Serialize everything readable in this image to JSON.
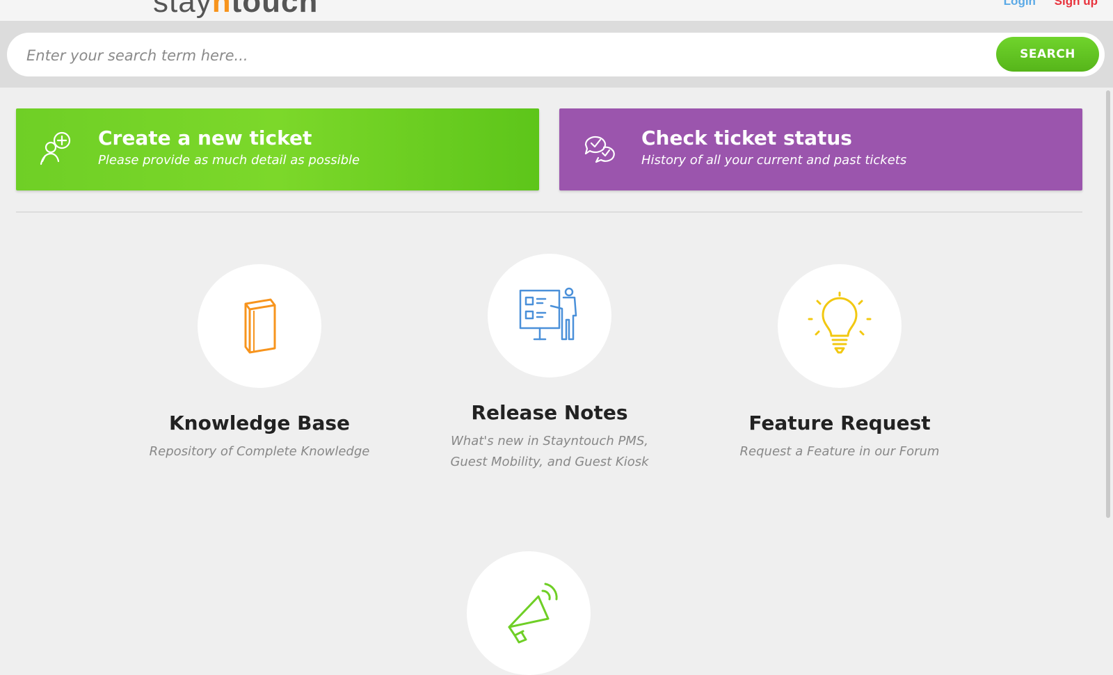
{
  "header": {
    "logo_brand": "stay",
    "logo_accent": "n",
    "logo_suffix": "touch",
    "login_label": "Login",
    "signup_label": "Sign up"
  },
  "search": {
    "placeholder": "Enter your search term here...",
    "button_label": "SEARCH"
  },
  "actions": [
    {
      "title": "Create a new ticket",
      "subtitle": "Please provide as much detail as possible",
      "icon": "person-plus-chat-icon",
      "color": "#6fcf26"
    },
    {
      "title": "Check ticket status",
      "subtitle": "History of all your current and past tickets",
      "icon": "chat-check-icon",
      "color": "#9b55ad"
    }
  ],
  "tiles": [
    {
      "title": "Knowledge Base",
      "subtitle": "Repository of Complete Knowledge",
      "icon": "book-icon",
      "color": "#f7941d"
    },
    {
      "title": "Release Notes",
      "subtitle_line1": "What's new in Stayntouch PMS,",
      "subtitle_line2": "Guest Mobility, and Guest Kiosk",
      "icon": "presentation-board-icon",
      "color": "#4a90d9"
    },
    {
      "title": "Feature Request",
      "subtitle": "Request a Feature in our Forum",
      "icon": "lightbulb-icon",
      "color": "#f2c811"
    },
    {
      "icon": "megaphone-icon",
      "color": "#6fcf26"
    }
  ]
}
